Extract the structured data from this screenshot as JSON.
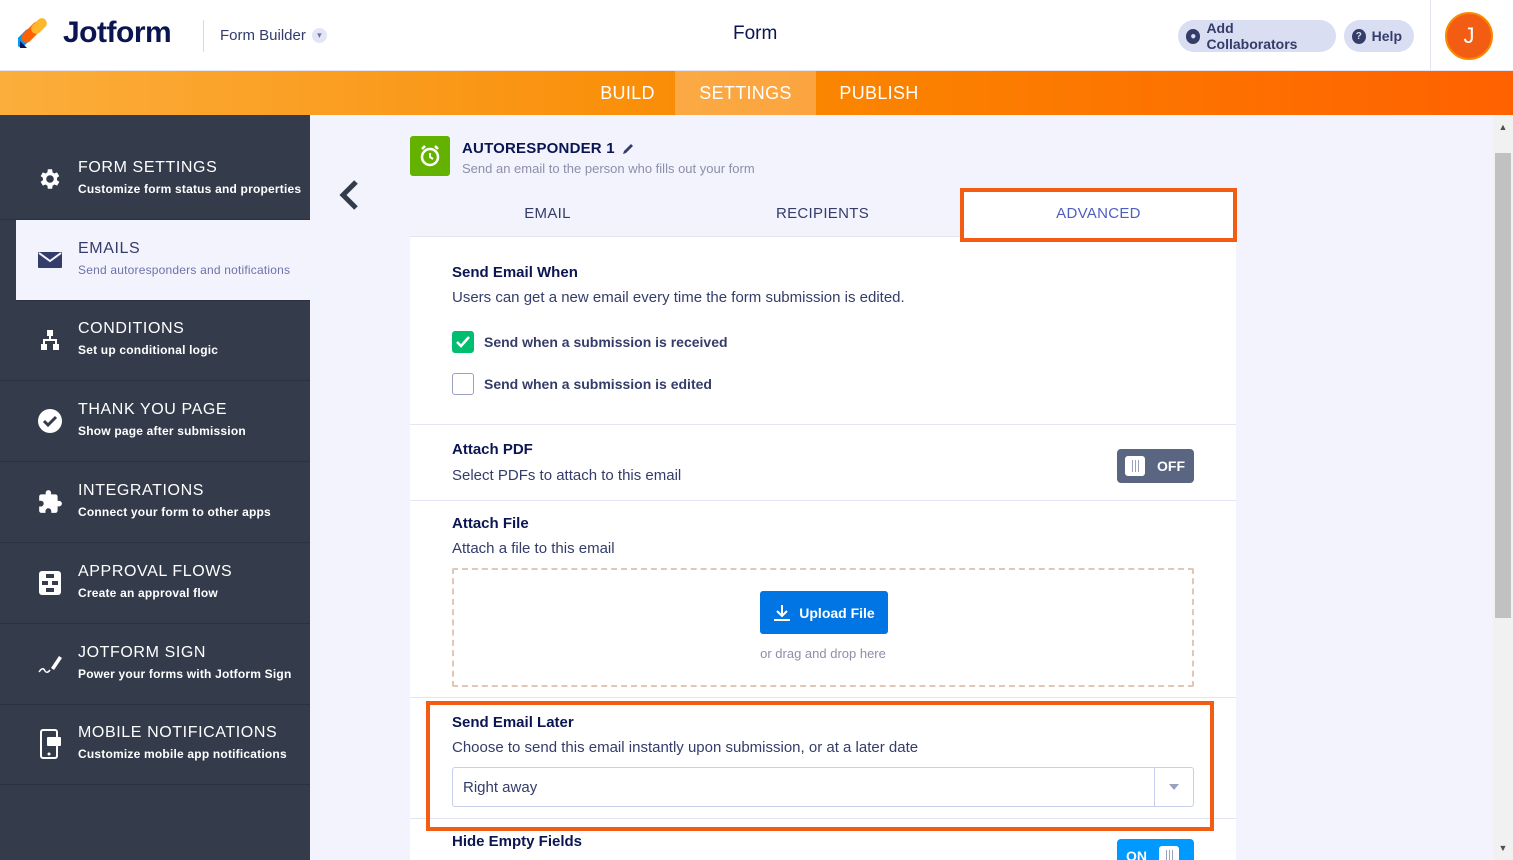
{
  "app": {
    "brand": "Jotform",
    "builder_menu": "Form Builder",
    "form_title": "Form",
    "add_collaborators": "Add Collaborators",
    "help": "Help",
    "avatar_initial": "J"
  },
  "nav": {
    "build": "BUILD",
    "settings": "SETTINGS",
    "publish": "PUBLISH",
    "active": "settings"
  },
  "sidebar": {
    "items": [
      {
        "title": "FORM SETTINGS",
        "sub": "Customize form status and properties",
        "icon": "gear-icon"
      },
      {
        "title": "EMAILS",
        "sub": "Send autoresponders and notifications",
        "icon": "envelope-icon",
        "active": true
      },
      {
        "title": "CONDITIONS",
        "sub": "Set up conditional logic",
        "icon": "conditions-icon"
      },
      {
        "title": "THANK YOU PAGE",
        "sub": "Show page after submission",
        "icon": "check-circle-icon"
      },
      {
        "title": "INTEGRATIONS",
        "sub": "Connect your form to other apps",
        "icon": "puzzle-icon"
      },
      {
        "title": "APPROVAL FLOWS",
        "sub": "Create an approval flow",
        "icon": "approval-flow-icon"
      },
      {
        "title": "JOTFORM SIGN",
        "sub": "Power your forms with Jotform Sign",
        "icon": "signature-pen-icon"
      },
      {
        "title": "MOBILE NOTIFICATIONS",
        "sub": "Customize mobile app notifications",
        "icon": "mobile-notification-icon"
      }
    ]
  },
  "autoresponder": {
    "title": "AUTORESPONDER 1",
    "subtitle": "Send an email to the person who fills out your form"
  },
  "tabs": {
    "email": "EMAIL",
    "recipients": "RECIPIENTS",
    "advanced": "ADVANCED",
    "active": "advanced"
  },
  "send_when": {
    "title": "Send Email When",
    "desc": "Users can get a new email every time the form submission is edited.",
    "options": [
      {
        "label": "Send when a submission is received",
        "checked": true
      },
      {
        "label": "Send when a submission is edited",
        "checked": false
      }
    ]
  },
  "attach_pdf": {
    "title": "Attach PDF",
    "desc": "Select PDFs to attach to this email",
    "toggle_label": "OFF"
  },
  "attach_file": {
    "title": "Attach File",
    "desc": "Attach a file to this email",
    "upload_label": "Upload File",
    "drag_text": "or drag and drop here"
  },
  "send_later": {
    "title": "Send Email Later",
    "desc": "Choose to send this email instantly upon submission, or at a later date",
    "selected": "Right away"
  },
  "hide_empty": {
    "title": "Hide Empty Fields",
    "toggle_label": "ON"
  },
  "colors": {
    "accent_orange": "#f25d13",
    "success_green": "#01bd6f",
    "upload_blue": "#0075e3",
    "sidebar_bg": "#343c4c"
  }
}
